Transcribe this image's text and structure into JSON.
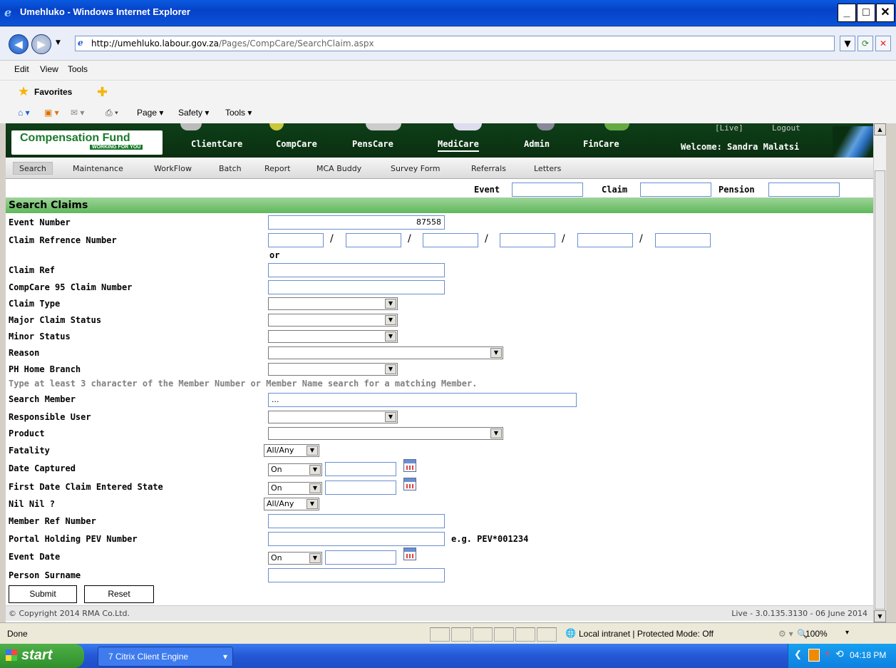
{
  "window": {
    "title": "Umehluko - Windows Internet Explorer"
  },
  "address": {
    "host": "http://umehluko.labour.gov.za",
    "path": "/Pages/CompCare/SearchClaim.aspx"
  },
  "menu": {
    "edit": "Edit",
    "view": "View",
    "tools": "Tools"
  },
  "favbar": {
    "favorites": "Favorites"
  },
  "cmdbar": {
    "page": "Page ▾",
    "safety": "Safety ▾",
    "tools": "Tools ▾"
  },
  "app": {
    "logo_main": "Compensation Fund",
    "logo_sub": "WORKING FOR YOU",
    "modules": [
      "ClientCare",
      "CompCare",
      "PensCare",
      "MediCare",
      "Admin",
      "FinCare"
    ],
    "live": "[Live]",
    "logout": "Logout",
    "welcome": "Welcome: Sandra Malatsi"
  },
  "subnav": [
    "Search",
    "Maintenance",
    "WorkFlow",
    "Batch",
    "Report",
    "MCA Buddy",
    "Survey Form",
    "Referrals",
    "Letters"
  ],
  "quick": {
    "event": "Event",
    "claim": "Claim",
    "pension": "Pension"
  },
  "form": {
    "header": "Search Claims",
    "event_number_label": "Event Number",
    "event_number_value": "87558",
    "claim_ref_number_label": "Claim Refrence Number",
    "or": "or",
    "claim_ref_label": "Claim Ref",
    "cc95_label": "CompCare 95 Claim Number",
    "claim_type_label": "Claim Type",
    "major_status_label": "Major Claim Status",
    "minor_status_label": "Minor Status",
    "reason_label": "Reason",
    "ph_branch_label": "PH Home Branch",
    "hint": "Type at least 3 character of the Member Number or Member Name search for a matching Member.",
    "search_member_label": "Search Member",
    "search_member_value": "...",
    "resp_user_label": "Responsible User",
    "product_label": "Product",
    "fatality_label": "Fatality",
    "fatality_value": "All/Any",
    "date_captured_label": "Date Captured",
    "date_captured_op": "On",
    "first_date_label": "First Date Claim Entered State",
    "first_date_op": "On",
    "nilnil_label": "Nil Nil ?",
    "nilnil_value": "All/Any",
    "member_ref_label": "Member Ref Number",
    "portal_label": "Portal Holding PEV Number",
    "portal_example": "e.g. PEV*001234",
    "event_date_label": "Event Date",
    "event_date_op": "On",
    "surname_label": "Person Surname",
    "submit": "Submit",
    "reset": "Reset"
  },
  "footer": {
    "copyright": "© Copyright 2014 RMA Co.Ltd.",
    "version": "Live - 3.0.135.3130 - 06 June 2014"
  },
  "status": {
    "done": "Done",
    "zone": "Local intranet | Protected Mode: Off",
    "zoom": "100%"
  },
  "taskbar": {
    "start": "start",
    "task": "7 Citrix Client Engine",
    "clock": "04:18 PM"
  }
}
